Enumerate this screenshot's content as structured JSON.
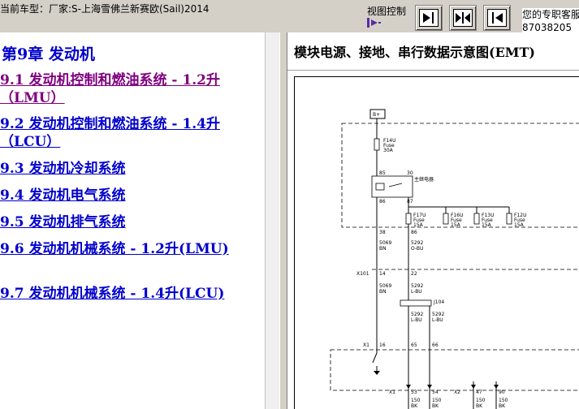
{
  "header": {
    "title": "当前车型：厂家:S-上海雪佛兰新赛欧(Sail)2014",
    "view_control_label": "视图控制",
    "view_buttons": [
      "collapse-left",
      "split-center",
      "collapse-right"
    ],
    "contact_line1": "您的专职客服",
    "contact_line2": "87038205"
  },
  "toc": {
    "chapter_title": "第9章 发动机",
    "items": [
      {
        "label": "9.1 发动机控制和燃油系统 - 1.2升（LMU）",
        "visited": true
      },
      {
        "label": "9.2 发动机控制和燃油系统 - 1.4升（LCU）",
        "visited": false
      },
      {
        "label": "9.3 发动机冷却系统",
        "visited": false
      },
      {
        "label": "9.4 发动机电气系统",
        "visited": false
      },
      {
        "label": "9.5 发动机排气系统",
        "visited": false
      },
      {
        "label": "9.6 发动机机械系统 - 1.2升(LMU)",
        "visited": false
      },
      {
        "label": "9.7 发动机机械系统 - 1.4升(LCU)",
        "visited": false
      }
    ]
  },
  "content": {
    "title": "模块电源、接地、串行数据示意图(EMT)",
    "diagram": {
      "b_plus": "B+",
      "fuse_main": [
        "F14U",
        "Fuse",
        "30A"
      ],
      "relay_label": "主继电器",
      "relay_pins": [
        "85",
        "30",
        "86",
        "87"
      ],
      "fuses": [
        [
          "F17U",
          "Fuse",
          "15A"
        ],
        [
          "F16U",
          "Fuse",
          "15A"
        ],
        [
          "F13U",
          "Fuse",
          "15A"
        ],
        [
          "F12U",
          "Fuse",
          "15A"
        ]
      ],
      "pins_a": [
        "38",
        "86"
      ],
      "wires_a": [
        [
          "5069",
          "BN"
        ],
        [
          "5292",
          "O-BU"
        ]
      ],
      "connector_x101": "X101",
      "pins_b": [
        "14",
        "22"
      ],
      "wires_b": [
        [
          "5069",
          "BN"
        ],
        [
          "5292",
          "L-BU"
        ]
      ],
      "splice": "J104",
      "wires_c": [
        [
          "5292",
          "L-BU"
        ],
        [
          "5292",
          "L-BU"
        ]
      ],
      "connector_x1": "X1",
      "pins_c": [
        "16",
        "65",
        "66"
      ],
      "bottom_x1": "X1",
      "bottom_x2": "X2",
      "bottom_pins": [
        "53",
        "54",
        "47",
        "90"
      ],
      "bottom_wires": [
        "150",
        "150",
        "150",
        "150"
      ],
      "bottom_colors": [
        "BK",
        "BK",
        "BK",
        "BK"
      ]
    }
  },
  "colors": {
    "link": "#0000cc",
    "visited": "#800080",
    "chrome": "#d4d0c8"
  }
}
